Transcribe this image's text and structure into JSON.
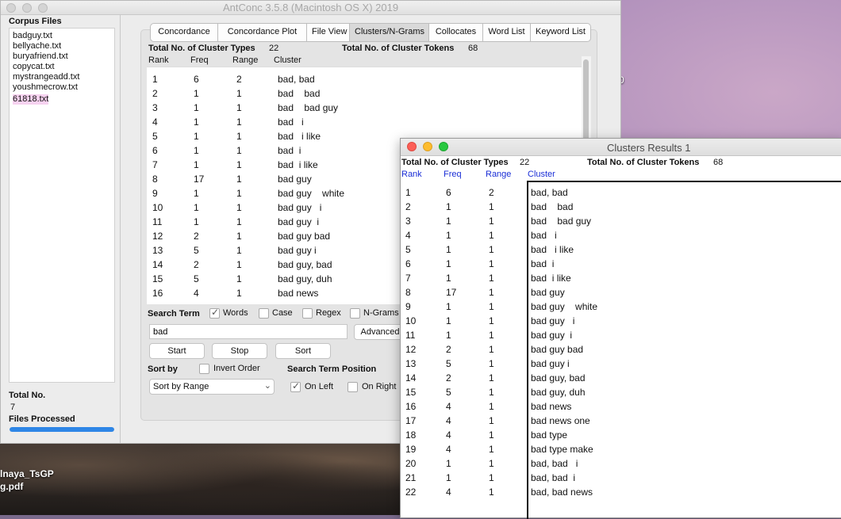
{
  "desktop": {
    "file_label_1": "lnaya_TsGP",
    "file_label_2": "g.pdf",
    "stray_digit": "0"
  },
  "main_window": {
    "title": "AntConc 3.5.8 (Macintosh OS X) 2019",
    "corpus_files_header": "Corpus Files",
    "files": [
      "badguy.txt",
      "bellyache.txt",
      "buryafriend.txt",
      "copycat.txt",
      "mystrangeadd.txt",
      "youshmecrow.txt",
      "61818.txt"
    ],
    "total_no_label": "Total No.",
    "total_no_value": "7",
    "files_processed_label": "Files Processed",
    "files_processed_progress": 1.0,
    "tabs": [
      "Concordance",
      "Concordance Plot",
      "File View",
      "Clusters/N-Grams",
      "Collocates",
      "Word List",
      "Keyword List"
    ],
    "active_tab": "Clusters/N-Grams",
    "cluster_types_label": "Total No. of Cluster Types",
    "cluster_types_value": "22",
    "cluster_tokens_label": "Total No. of Cluster Tokens",
    "cluster_tokens_value": "68",
    "columns": [
      "Rank",
      "Freq",
      "Range",
      "Cluster"
    ],
    "search_term_label": "Search Term",
    "options": {
      "words": "Words",
      "case": "Case",
      "regex": "Regex",
      "ngrams": "N-Grams"
    },
    "search_value": "bad",
    "advanced_label": "Advanced",
    "start_label": "Start",
    "stop_label": "Stop",
    "sort_label": "Sort",
    "sort_by_label": "Sort by",
    "invert_order_label": "Invert Order",
    "search_term_position_label": "Search Term Position",
    "sort_by_value": "Sort by Range",
    "on_left_label": "On Left",
    "on_right_label": "On Right"
  },
  "results_window": {
    "title": "Clusters Results 1",
    "cluster_types_label": "Total No. of Cluster Types",
    "cluster_types_value": "22",
    "cluster_tokens_label": "Total No. of Cluster Tokens",
    "cluster_tokens_value": "68",
    "columns": [
      "Rank",
      "Freq",
      "Range",
      "Cluster"
    ]
  },
  "rows": [
    {
      "rank": "1",
      "freq": "6",
      "range": "2",
      "cluster": "bad, bad"
    },
    {
      "rank": "2",
      "freq": "1",
      "range": "1",
      "cluster": "bad    bad"
    },
    {
      "rank": "3",
      "freq": "1",
      "range": "1",
      "cluster": "bad    bad guy"
    },
    {
      "rank": "4",
      "freq": "1",
      "range": "1",
      "cluster": "bad   i"
    },
    {
      "rank": "5",
      "freq": "1",
      "range": "1",
      "cluster": "bad   i like"
    },
    {
      "rank": "6",
      "freq": "1",
      "range": "1",
      "cluster": "bad  i"
    },
    {
      "rank": "7",
      "freq": "1",
      "range": "1",
      "cluster": "bad  i like"
    },
    {
      "rank": "8",
      "freq": "17",
      "range": "1",
      "cluster": "bad guy"
    },
    {
      "rank": "9",
      "freq": "1",
      "range": "1",
      "cluster": "bad guy    white"
    },
    {
      "rank": "10",
      "freq": "1",
      "range": "1",
      "cluster": "bad guy   i"
    },
    {
      "rank": "11",
      "freq": "1",
      "range": "1",
      "cluster": "bad guy  i"
    },
    {
      "rank": "12",
      "freq": "2",
      "range": "1",
      "cluster": "bad guy bad"
    },
    {
      "rank": "13",
      "freq": "5",
      "range": "1",
      "cluster": "bad guy i"
    },
    {
      "rank": "14",
      "freq": "2",
      "range": "1",
      "cluster": "bad guy, bad"
    },
    {
      "rank": "15",
      "freq": "5",
      "range": "1",
      "cluster": "bad guy, duh"
    },
    {
      "rank": "16",
      "freq": "4",
      "range": "1",
      "cluster": "bad news"
    },
    {
      "rank": "17",
      "freq": "4",
      "range": "1",
      "cluster": "bad news one"
    },
    {
      "rank": "18",
      "freq": "4",
      "range": "1",
      "cluster": "bad type"
    },
    {
      "rank": "19",
      "freq": "4",
      "range": "1",
      "cluster": "bad type make"
    },
    {
      "rank": "20",
      "freq": "1",
      "range": "1",
      "cluster": "bad, bad   i"
    },
    {
      "rank": "21",
      "freq": "1",
      "range": "1",
      "cluster": "bad, bad  i"
    },
    {
      "rank": "22",
      "freq": "4",
      "range": "1",
      "cluster": "bad, bad news"
    }
  ]
}
